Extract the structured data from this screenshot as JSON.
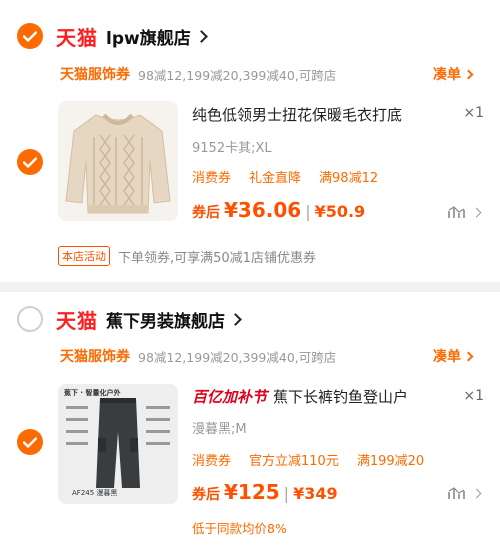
{
  "store1": {
    "brand": "天猫",
    "name": "lpw旗舰店",
    "promo_tag": "天猫服饰券",
    "promo_text": "98减12,199减20,399减40,可跨店",
    "coupon_link": "凑单",
    "item": {
      "title": "纯色低领男士扭花保暖毛衣打底",
      "qty": "×1",
      "sku": "9152卡其;XL",
      "tags": [
        "消费券",
        "礼金直降",
        "满98减12"
      ],
      "price_label": "券后",
      "price": "¥36.06",
      "separator": "|",
      "orig_price": "¥50.9"
    },
    "activity_badge": "本店活动",
    "activity_text": "下单领券,可享满50减1店铺优惠券"
  },
  "store2": {
    "brand": "天猫",
    "name": "蕉下男装旗舰店",
    "promo_tag": "天猫服饰券",
    "promo_text": "98减12,199减20,399减40,可跨店",
    "coupon_link": "凑单",
    "item": {
      "badge": "百亿加补节",
      "title": "蕉下长裤钓鱼登山户",
      "qty": "×1",
      "sku": "漫暮黑;M",
      "tags": [
        "消费券",
        "官方立减110元",
        "满199减20"
      ],
      "price_label": "券后",
      "price": "¥125",
      "separator": "|",
      "orig_price": "¥349",
      "lowest_note": "低于同款均价8%",
      "thumb_header": "蕉下 · 智量化户外",
      "thumb_model": "AF245 漫暮黑"
    }
  },
  "colors": {
    "accent": "#ff6a00",
    "tmall_red": "#ff1f1f",
    "price": "#ff5000"
  }
}
